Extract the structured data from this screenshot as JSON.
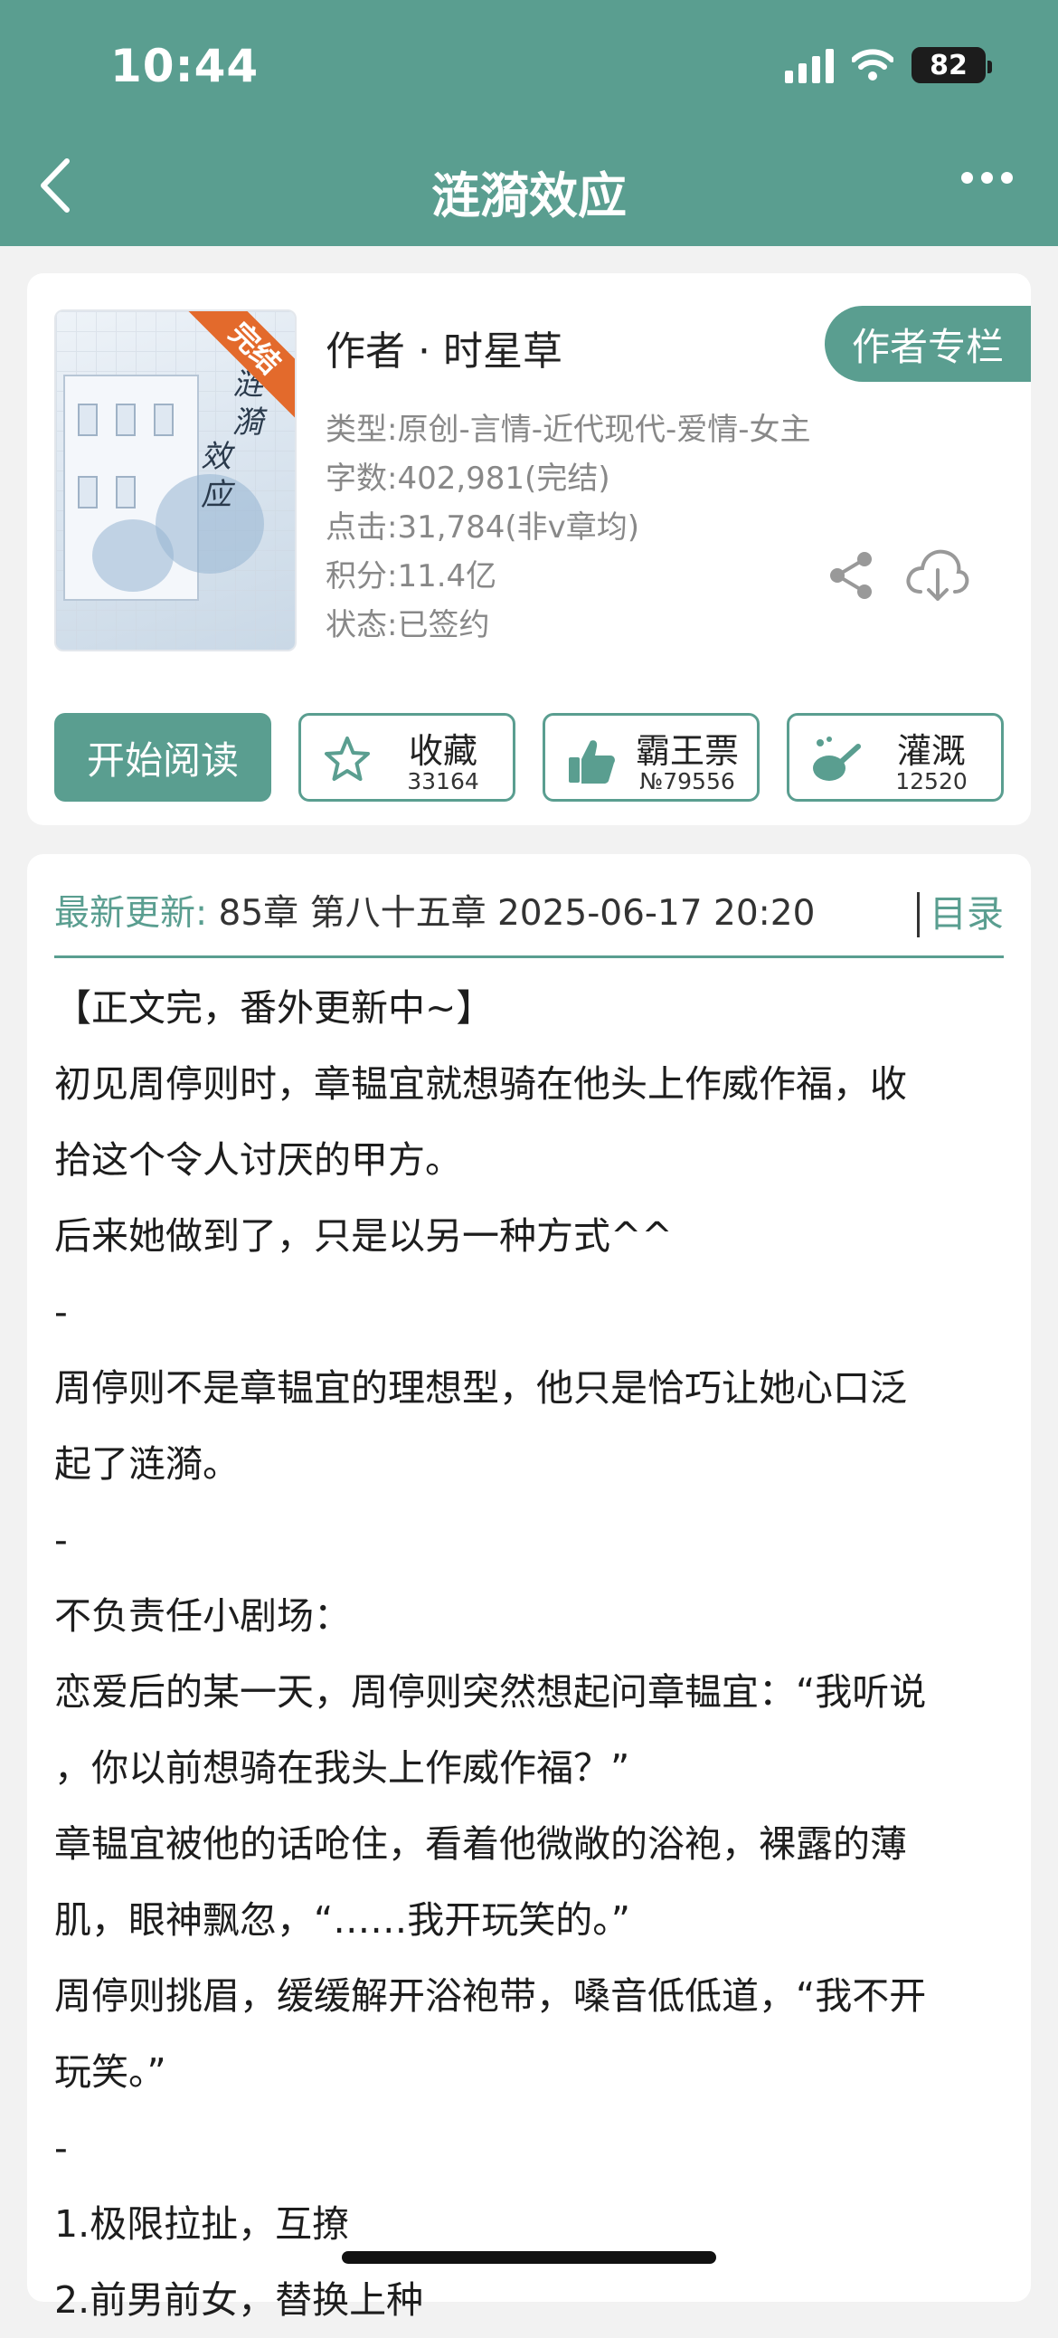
{
  "status_bar": {
    "time": "10:44",
    "battery": "82"
  },
  "nav": {
    "title": "涟漪效应"
  },
  "book": {
    "cover_badge": "完结",
    "cover_title_a": "涟漪",
    "cover_title_b": "效应",
    "author": "作者 · 时星草",
    "author_column_label": "作者专栏",
    "meta": [
      "类型:原创-言情-近代现代-爱情-女主",
      "字数:402,981(完结)",
      "点击:31,784(非v章均)",
      "积分:11.4亿",
      "状态:已签约"
    ]
  },
  "actions": {
    "read_label": "开始阅读",
    "favorite": {
      "label": "收藏",
      "count": "33164"
    },
    "vote": {
      "label": "霸王票",
      "count": "№79556"
    },
    "water": {
      "label": "灌溉",
      "count": "12520"
    }
  },
  "update": {
    "label": "最新更新:",
    "text": "85章 第八十五章 2025-06-17 20:20",
    "toc_label": "目录"
  },
  "intro_lines": [
    "【正文完，番外更新中~】",
    "初见周停则时，章韫宜就想骑在他头上作威作福，收",
    "拾这个令人讨厌的甲方。",
    "后来她做到了，只是以另一种方式^^",
    "-",
    "周停则不是章韫宜的理想型，他只是恰巧让她心口泛",
    "起了涟漪。",
    "-",
    "不负责任小剧场：",
    "恋爱后的某一天，周停则突然想起问章韫宜：“我听说",
    "，你以前想骑在我头上作威作福？”",
    "章韫宜被他的话呛住，看着他微敞的浴袍，裸露的薄",
    "肌，眼神飘忽，“……我开玩笑的。”",
    "周停则挑眉，缓缓解开浴袍带，嗓音低低道，“我不开",
    "玩笑。”",
    "-",
    "1.极限拉扯，互撩",
    "2.前男前女，替换上种"
  ],
  "colors": {
    "theme": "#5a9e90",
    "badge": "#e36a2c"
  }
}
